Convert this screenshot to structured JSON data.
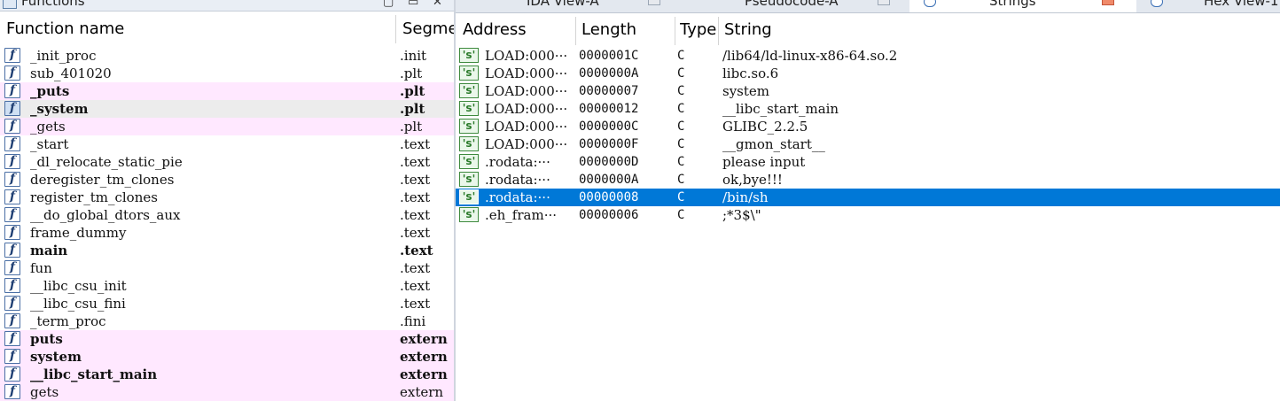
{
  "functions_pane": {
    "title": "Functions",
    "columns": {
      "name": "Function name",
      "segment": "Segment"
    },
    "rows": [
      {
        "name": "_init_proc",
        "segment": ".init",
        "style": "normal"
      },
      {
        "name": "sub_401020",
        "segment": ".plt",
        "style": "normal"
      },
      {
        "name": "_puts",
        "segment": ".plt",
        "style": "pink-bold"
      },
      {
        "name": "_system",
        "segment": ".plt",
        "style": "selected-bold"
      },
      {
        "name": "_gets",
        "segment": ".plt",
        "style": "pink"
      },
      {
        "name": "_start",
        "segment": ".text",
        "style": "normal"
      },
      {
        "name": "_dl_relocate_static_pie",
        "segment": ".text",
        "style": "normal"
      },
      {
        "name": "deregister_tm_clones",
        "segment": ".text",
        "style": "normal"
      },
      {
        "name": "register_tm_clones",
        "segment": ".text",
        "style": "normal"
      },
      {
        "name": "__do_global_dtors_aux",
        "segment": ".text",
        "style": "normal"
      },
      {
        "name": "frame_dummy",
        "segment": ".text",
        "style": "normal"
      },
      {
        "name": "main",
        "segment": ".text",
        "style": "bold"
      },
      {
        "name": "fun",
        "segment": ".text",
        "style": "normal"
      },
      {
        "name": "__libc_csu_init",
        "segment": ".text",
        "style": "normal"
      },
      {
        "name": "__libc_csu_fini",
        "segment": ".text",
        "style": "normal"
      },
      {
        "name": "_term_proc",
        "segment": ".fini",
        "style": "normal"
      },
      {
        "name": "puts",
        "segment": "extern",
        "style": "pink-bold"
      },
      {
        "name": "system",
        "segment": "extern",
        "style": "pink-bold"
      },
      {
        "name": "__libc_start_main",
        "segment": "extern",
        "style": "pink-bold"
      },
      {
        "name": "gets",
        "segment": "extern",
        "style": "pink"
      }
    ]
  },
  "tabs": [
    {
      "label": "IDA View-A",
      "active": false
    },
    {
      "label": "Pseudocode-A",
      "active": false
    },
    {
      "label": "Strings",
      "active": true
    },
    {
      "label": "Hex View-1",
      "active": false
    }
  ],
  "strings_pane": {
    "columns": {
      "address": "Address",
      "length": "Length",
      "type": "Type",
      "string": "String"
    },
    "rows": [
      {
        "address": "LOAD:000···",
        "length": "0000001C",
        "type": "C",
        "string": "/lib64/ld-linux-x86-64.so.2",
        "selected": false
      },
      {
        "address": "LOAD:000···",
        "length": "0000000A",
        "type": "C",
        "string": "libc.so.6",
        "selected": false
      },
      {
        "address": "LOAD:000···",
        "length": "00000007",
        "type": "C",
        "string": "system",
        "selected": false
      },
      {
        "address": "LOAD:000···",
        "length": "00000012",
        "type": "C",
        "string": "__libc_start_main",
        "selected": false
      },
      {
        "address": "LOAD:000···",
        "length": "0000000C",
        "type": "C",
        "string": "GLIBC_2.2.5",
        "selected": false
      },
      {
        "address": "LOAD:000···",
        "length": "0000000F",
        "type": "C",
        "string": "__gmon_start__",
        "selected": false
      },
      {
        "address": ".rodata:···",
        "length": "0000000D",
        "type": "C",
        "string": "please input",
        "selected": false
      },
      {
        "address": ".rodata:···",
        "length": "0000000A",
        "type": "C",
        "string": "ok,bye!!!",
        "selected": false
      },
      {
        "address": ".rodata:···",
        "length": "00000008",
        "type": "C",
        "string": "/bin/sh",
        "selected": true
      },
      {
        "address": ".eh_fram···",
        "length": "00000006",
        "type": "C",
        "string": ";*3$\\\"",
        "selected": false
      }
    ]
  },
  "icons": {
    "function_row": "function-icon",
    "string_row": "string-icon",
    "function_glyph": "f",
    "string_glyph": "'s'"
  },
  "colors": {
    "selection": "#0078d7",
    "pink_row": "#ffe8ff",
    "selected_function_row": "#ececec"
  }
}
